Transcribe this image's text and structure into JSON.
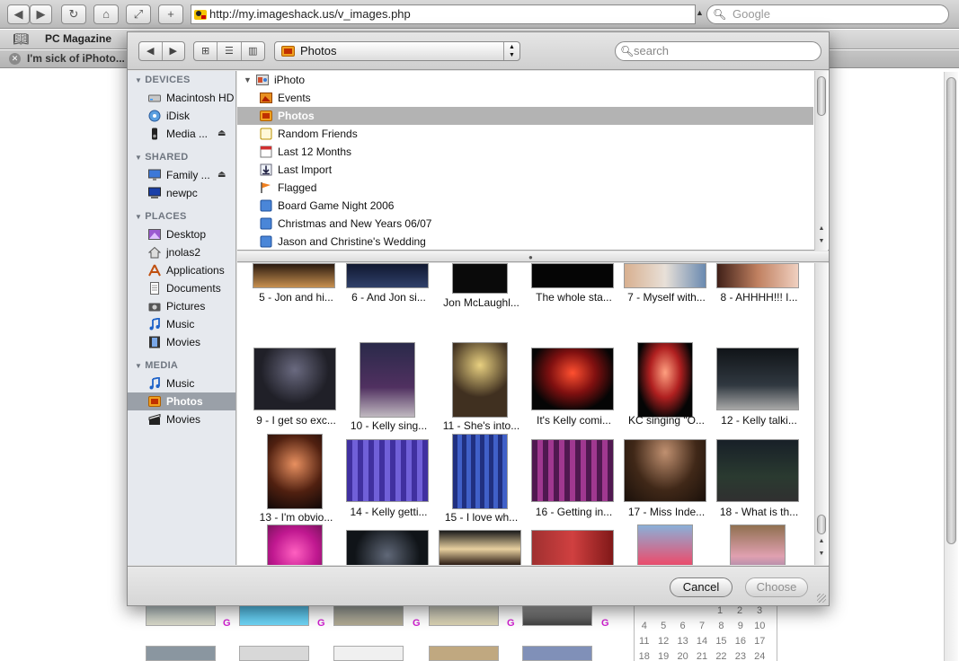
{
  "browser": {
    "url": "http://my.imageshack.us/v_images.php",
    "search_placeholder": "Google",
    "bookmark_label": "PC Magazine",
    "tab_title": "I'm sick of iPhoto..."
  },
  "dialog": {
    "location": "Photos",
    "search_placeholder": "search",
    "sidebar": {
      "devices_heading": "DEVICES",
      "devices": [
        "Macintosh HD",
        "iDisk",
        "Media ..."
      ],
      "shared_heading": "SHARED",
      "shared": [
        "Family ...",
        "newpc"
      ],
      "places_heading": "PLACES",
      "places": [
        "Desktop",
        "jnolas2",
        "Applications",
        "Documents",
        "Pictures",
        "Music",
        "Movies"
      ],
      "media_heading": "MEDIA",
      "media": [
        "Music",
        "Photos",
        "Movies"
      ],
      "selected": "Photos"
    },
    "sources": {
      "root": "iPhoto",
      "items": [
        "Events",
        "Photos",
        "Random Friends",
        "Last 12 Months",
        "Last Import",
        "Flagged",
        "Board Game Night 2006",
        "Christmas and New Years 06/07",
        "Jason and Christine's Wedding"
      ],
      "selected": "Photos"
    },
    "photos": {
      "row1": [
        "5 - Jon and hi...",
        "6 - And Jon si...",
        "Jon McLaughl...",
        "The whole sta...",
        "7 - Myself with...",
        "8 - AHHHH!!! I..."
      ],
      "row2": [
        "9 - I get so exc...",
        "10 - Kelly sing...",
        "11 - She's into...",
        "It's Kelly comi...",
        "KC singing \"O...",
        "12 - Kelly talki..."
      ],
      "row3": [
        "13 - I'm obvio...",
        "14 - Kelly getti...",
        "15 - I love wh...",
        "16 - Getting in...",
        "17 - Miss Inde...",
        "18 - What is th..."
      ]
    },
    "cancel_label": "Cancel",
    "choose_label": "Choose"
  },
  "background": {
    "calendar_rows": [
      [
        "1",
        "2",
        "3"
      ],
      [
        "4",
        "5",
        "6",
        "7",
        "8",
        "9",
        "10"
      ],
      [
        "11",
        "12",
        "13",
        "14",
        "15",
        "16",
        "17"
      ],
      [
        "18",
        "19",
        "20",
        "21",
        "22",
        "23",
        "24"
      ]
    ]
  }
}
